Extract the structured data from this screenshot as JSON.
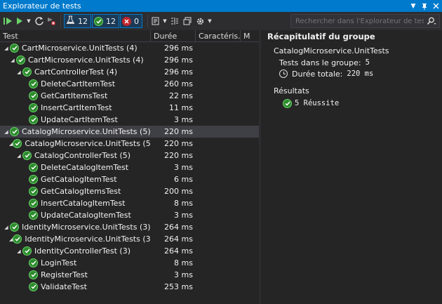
{
  "window": {
    "title": "Explorateur de tests"
  },
  "toolbar": {
    "filter_all_count": "12",
    "filter_passed_count": "12",
    "filter_failed_count": "0"
  },
  "search": {
    "placeholder": "Rechercher dans l'Explorateur de tests"
  },
  "columns": {
    "test": "Test",
    "duration": "Durée",
    "traits": "Caractéris...",
    "m": "M"
  },
  "tree": [
    {
      "name": "CartMicroservice.UnitTests (4)",
      "duration": "296 ms"
    },
    {
      "name": "CartMicroservice.UnitTests (4)",
      "duration": "296 ms"
    },
    {
      "name": "CartControllerTest (4)",
      "duration": "296 ms"
    },
    {
      "name": "DeleteCartItemTest",
      "duration": "260 ms"
    },
    {
      "name": "GetCartItemsTest",
      "duration": "22 ms"
    },
    {
      "name": "InsertCartItemTest",
      "duration": "11 ms"
    },
    {
      "name": "UpdateCartItemTest",
      "duration": "3 ms"
    },
    {
      "name": "CatalogMicroservice.UnitTests (5)",
      "duration": "220 ms"
    },
    {
      "name": "CatalogMicroservice.UnitTests (5)",
      "duration": "220 ms"
    },
    {
      "name": "CatalogControllerTest (5)",
      "duration": "220 ms"
    },
    {
      "name": "DeleteCatalogItemTest",
      "duration": "3 ms"
    },
    {
      "name": "GetCatalogItemTest",
      "duration": "6 ms"
    },
    {
      "name": "GetCatalogItemsTest",
      "duration": "200 ms"
    },
    {
      "name": "InsertCatalogItemTest",
      "duration": "8 ms"
    },
    {
      "name": "UpdateCatalogItemTest",
      "duration": "3 ms"
    },
    {
      "name": "IdentityMicroservice.UnitTests (3)",
      "duration": "264 ms"
    },
    {
      "name": "IdentityMicroservice.UnitTests (3)",
      "duration": "264 ms"
    },
    {
      "name": "IdentityControllerTest (3)",
      "duration": "264 ms"
    },
    {
      "name": "LoginTest",
      "duration": "8 ms"
    },
    {
      "name": "RegisterTest",
      "duration": "3 ms"
    },
    {
      "name": "ValidateTest",
      "duration": "253 ms"
    }
  ],
  "summary": {
    "title": "Récapitulatif du groupe",
    "group_name": "CatalogMicroservice.UnitTests",
    "tests_label": "Tests dans le groupe:",
    "tests_value": "5",
    "duration_label": "Durée totale:",
    "duration_value": "220 ms",
    "results_title": "Résultats",
    "passed_text": "5 Réussite"
  },
  "colors": {
    "accent": "#007acc",
    "passed": "#2d8b2d",
    "failed": "#c0262d",
    "background": "#252526"
  },
  "icons": [
    "run-all-icon",
    "run-icon",
    "repeat-icon",
    "cancel-icon",
    "flask-icon",
    "check-circle-icon",
    "error-circle-icon",
    "playlist-icon",
    "group-by-icon",
    "settings-icon",
    "search-icon",
    "pin-icon",
    "close-icon",
    "clock-icon",
    "expand-arrow-icon"
  ]
}
